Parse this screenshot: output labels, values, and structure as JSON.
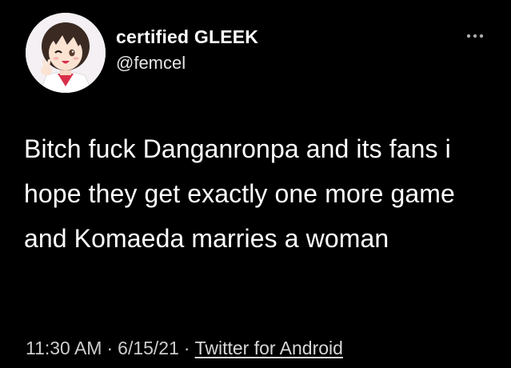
{
  "author": {
    "display_name": "certified GLEEK",
    "handle": "@femcel",
    "avatar_icon": "anime-girl-avatar"
  },
  "menu": {
    "icon": "more-horizontal-icon"
  },
  "tweet": {
    "text": "Bitch fuck Danganronpa and its fans i hope they get exactly one more game and Komaeda marries a woman"
  },
  "meta": {
    "time": "11:30 AM",
    "separator": "·",
    "date": "6/15/21",
    "source": "Twitter for Android"
  },
  "colors": {
    "background": "#000000",
    "text": "#ffffff",
    "meta_text": "#cccccc"
  }
}
